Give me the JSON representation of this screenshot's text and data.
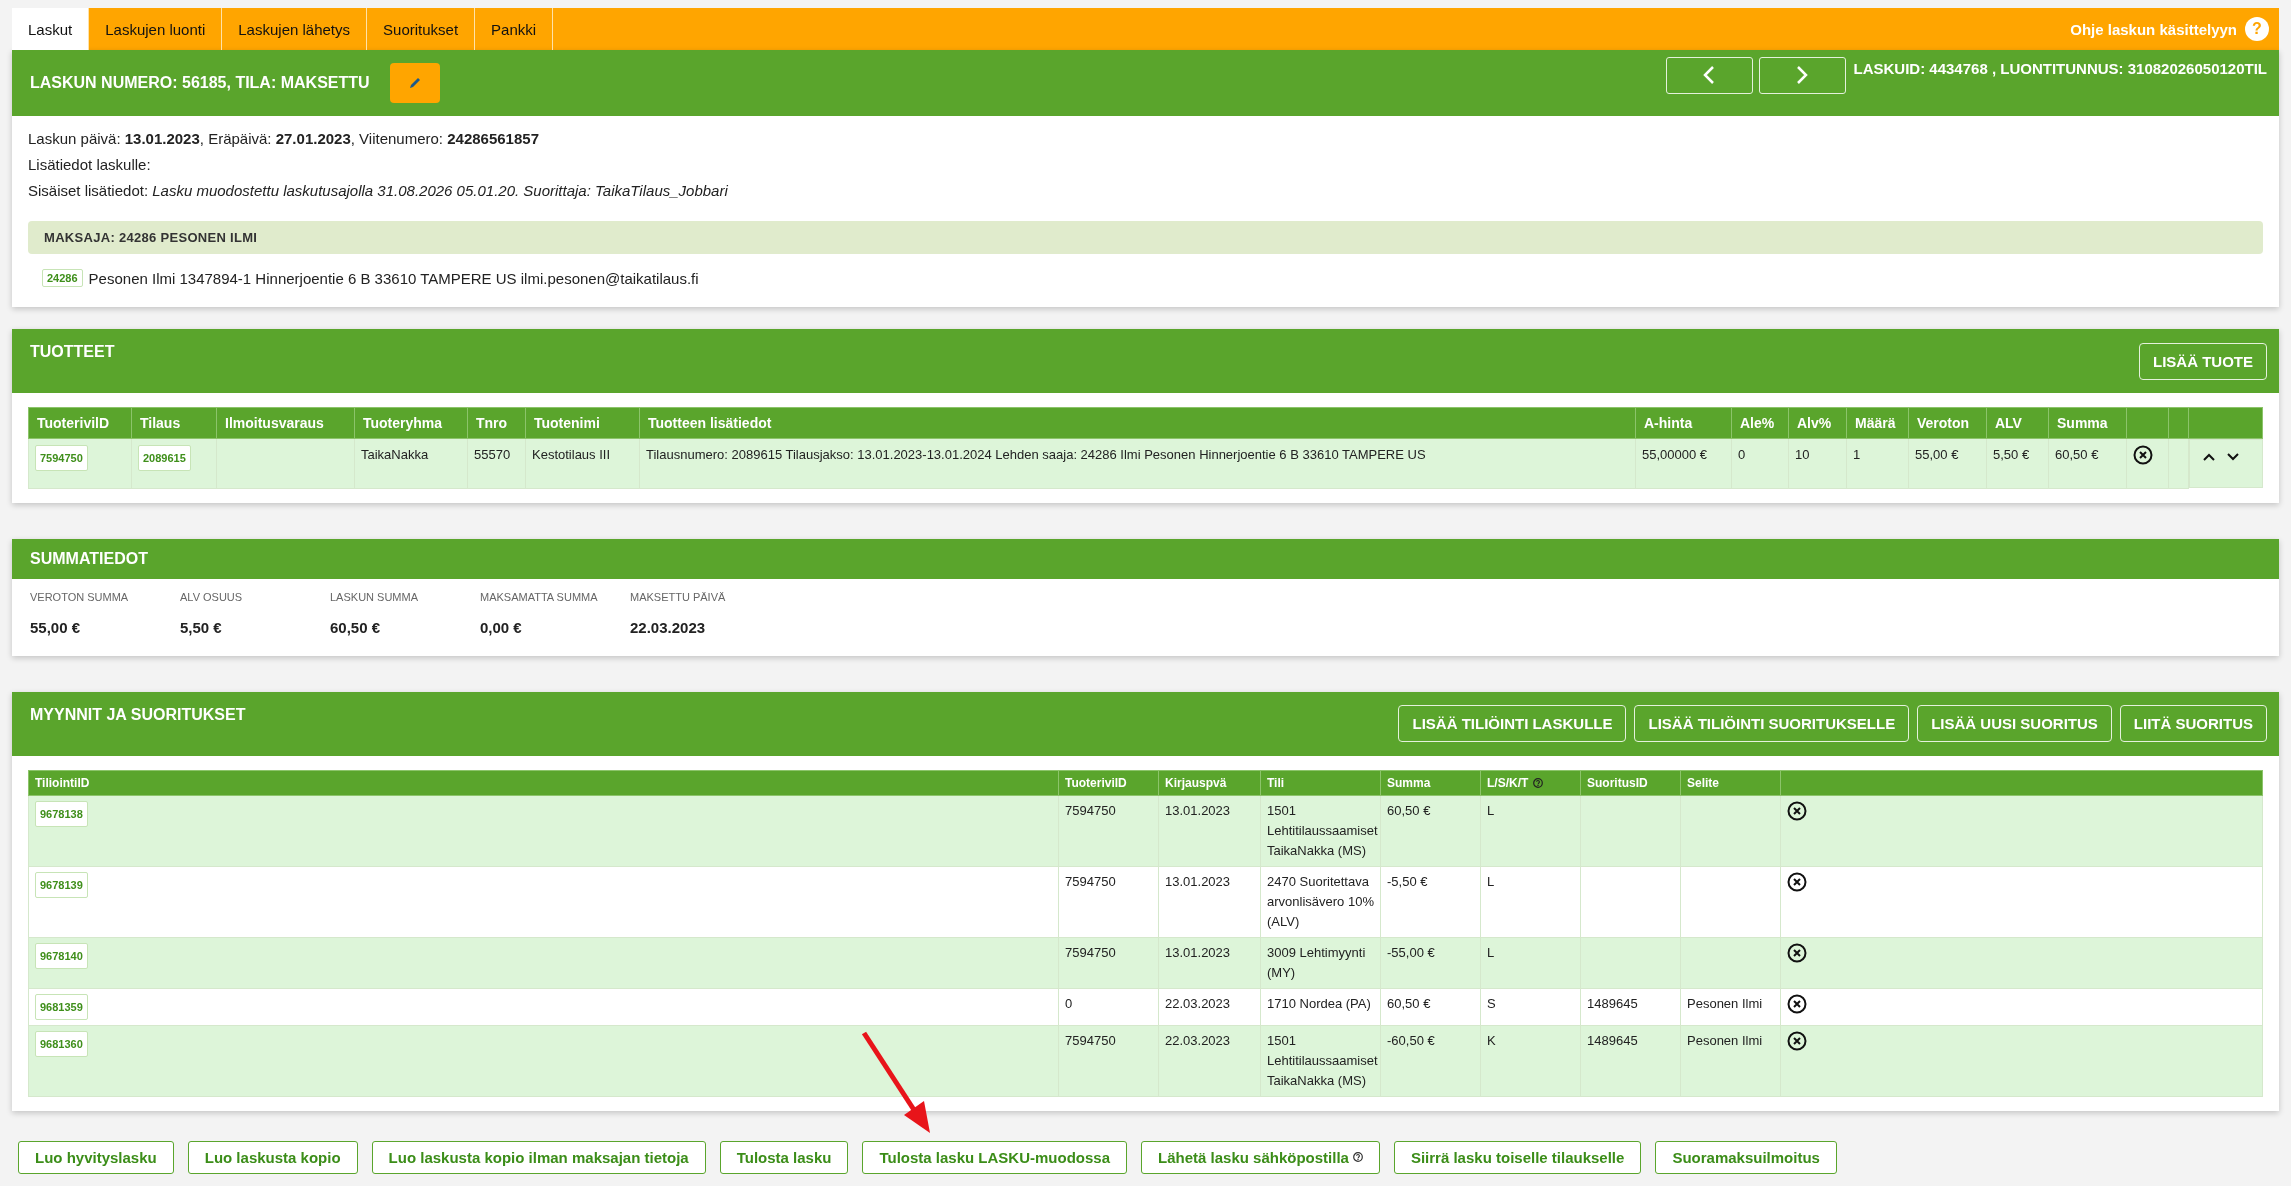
{
  "tabs": [
    {
      "label": "Laskut",
      "selected": true
    },
    {
      "label": "Laskujen luonti",
      "selected": false
    },
    {
      "label": "Laskujen lähetys",
      "selected": false
    },
    {
      "label": "Suoritukset",
      "selected": false
    },
    {
      "label": "Pankki",
      "selected": false
    }
  ],
  "help": {
    "label": "Ohje laskun käsittelyyn",
    "icon": "?"
  },
  "invoice": {
    "title": "LASKUN NUMERO: 56185, TILA: **MAKSETTU**",
    "ids": "LASKUID: 4434768 , LUONTITUNNUS: 31082026050120TIL",
    "info_lines": [
      "Laskun päivä: **13.01.2023**, Eräpäivä: **27.01.2023**, Viitenumero: **24286561857**",
      "Lisätiedot laskulle:",
      "Sisäiset lisätiedot: *Lasku muodostettu laskutusajolla 31.08.2026 05.01.20. Suorittaja: TaikaTilaus_Jobbari*"
    ],
    "payer": {
      "heading": "MAKSAJA: 24286 PESONEN ILMI",
      "badge": "24286",
      "details": "Pesonen Ilmi 1347894-1 Hinnerjoentie 6 B 33610 TAMPERE US ilmi.pesonen@taikatilaus.fi"
    }
  },
  "products": {
    "title": "TUOTTEET",
    "add_button": "LISÄÄ TUOTE",
    "columns": [
      "TuoterivilD",
      "Tilaus",
      "Ilmoitusvaraus",
      "Tuoteryhma",
      "Tnro",
      "Tuotenimi",
      "Tuotteen lisätiedot",
      "A-hinta",
      "Ale%",
      "Alv%",
      "Määrä",
      "Veroton",
      "ALV",
      "Summa"
    ],
    "rows": [
      {
        "cells": [
          "7594750",
          "2089615",
          "",
          "TaikaNakka",
          "55570",
          "Kestotilaus III",
          "Tilausnumero: 2089615 Tilausjakso: 13.01.2023-13.01.2024 Lehden saaja: 24286 Ilmi Pesonen Hinnerjoentie 6 B 33610 TAMPERE US",
          "55,00000 €",
          "0",
          "10",
          "1",
          "55,00 €",
          "5,50 €",
          "60,50 €"
        ]
      }
    ]
  },
  "summary": {
    "title": "SUMMATIEDOT",
    "items": [
      {
        "label": "VEROTON SUMMA",
        "value": "55,00 €"
      },
      {
        "label": "ALV OSUUS",
        "value": "5,50 €"
      },
      {
        "label": "LASKUN SUMMA",
        "value": "60,50 €"
      },
      {
        "label": "MAKSAMATTA SUMMA",
        "value": "0,00 €"
      },
      {
        "label": "MAKSETTU PÄIVÄ",
        "value": "22.03.2023"
      }
    ]
  },
  "sales": {
    "title": "MYYNNIT JA SUORITUKSET",
    "buttons": [
      "LISÄÄ TILIÖINTI LASKULLE",
      "LISÄÄ TILIÖINTI SUORITUKSELLE",
      "LISÄÄ UUSI SUORITUS",
      "LIITÄ SUORITUS"
    ],
    "columns": [
      {
        "label": "TiliointiID",
        "info": false
      },
      {
        "label": "TuoterivilD",
        "info": false
      },
      {
        "label": "Kirjauspvä",
        "info": false
      },
      {
        "label": "Tili",
        "info": false
      },
      {
        "label": "Summa",
        "info": false
      },
      {
        "label": "L/S/K/T",
        "info": true
      },
      {
        "label": "SuoritusID",
        "info": false
      },
      {
        "label": "Selite",
        "info": false
      }
    ],
    "rows": [
      {
        "cells": [
          "9678138",
          "7594750",
          "13.01.2023",
          "1501 Lehtitilaussaamiset TaikaNakka (MS)",
          "60,50 €",
          "L",
          "",
          ""
        ]
      },
      {
        "cells": [
          "9678139",
          "7594750",
          "13.01.2023",
          "2470 Suoritettava arvonlisävero 10% (ALV)",
          "-5,50 €",
          "L",
          "",
          ""
        ]
      },
      {
        "cells": [
          "9678140",
          "7594750",
          "13.01.2023",
          "3009 Lehtimyynti (MY)",
          "-55,00 €",
          "L",
          "",
          ""
        ]
      },
      {
        "cells": [
          "9681359",
          "0",
          "22.03.2023",
          "1710 Nordea (PA)",
          "60,50 €",
          "S",
          "1489645",
          "Pesonen Ilmi"
        ]
      },
      {
        "cells": [
          "9681360",
          "7594750",
          "22.03.2023",
          "1501 Lehtitilaussaamiset TaikaNakka (MS)",
          "-60,50 €",
          "K",
          "1489645",
          "Pesonen Ilmi"
        ]
      }
    ]
  },
  "actions": [
    {
      "label": "Luo hyvityslasku",
      "info": false
    },
    {
      "label": "Luo laskusta kopio",
      "info": false
    },
    {
      "label": "Luo laskusta kopio ilman maksajan tietoja",
      "info": false
    },
    {
      "label": "Tulosta lasku",
      "info": false
    },
    {
      "label": "Tulosta lasku LASKU-muodossa",
      "info": false
    },
    {
      "label": "Lähetä lasku sähköpostilla",
      "info": true
    },
    {
      "label": "Siirrä lasku toiselle tilaukselle",
      "info": false
    },
    {
      "label": "Suoramaksuilmoitus",
      "info": false
    }
  ]
}
